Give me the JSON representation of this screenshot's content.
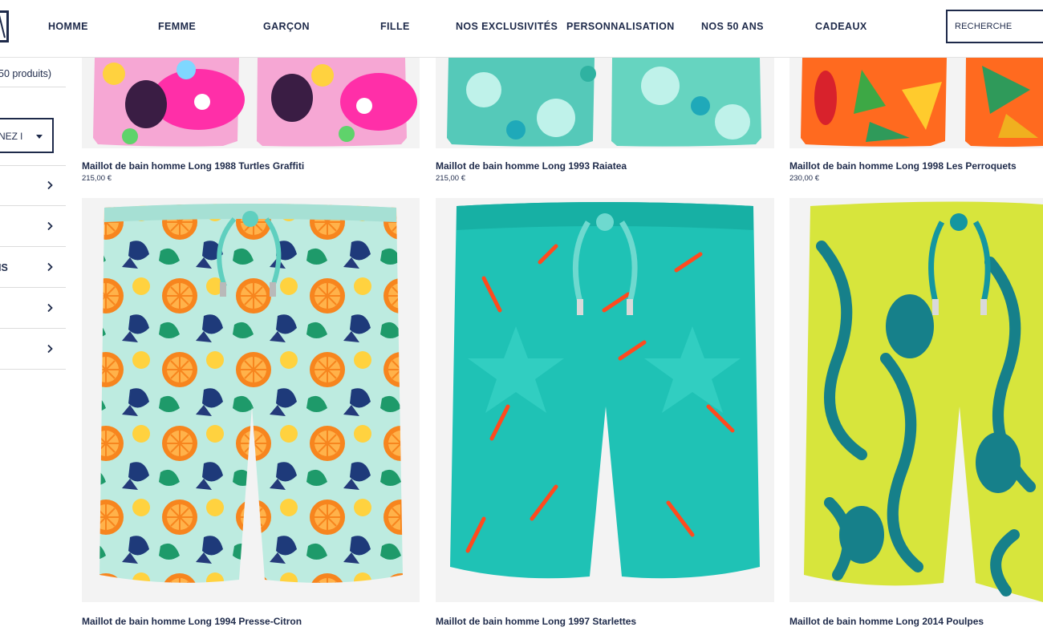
{
  "header": {
    "logo_text": "VB",
    "nav": [
      "HOMME",
      "FEMME",
      "GARÇON",
      "FILLE",
      "NOS EXCLUSIVITÉS",
      "PERSONNALISATION",
      "NOS 50 ANS",
      "CADEAUX"
    ],
    "search_placeholder": "RECHERCHE"
  },
  "sidebar": {
    "count_text": "50 produits)",
    "sort_label": "NEZ l",
    "filters": [
      "",
      "",
      "IS",
      "",
      ""
    ]
  },
  "products": [
    {
      "name": "Maillot de bain homme Long 1988 Turtles Graffiti",
      "price": "215,00 €",
      "pattern": "turtles-graffiti"
    },
    {
      "name": "Maillot de bain homme Long 1993 Raiatea",
      "price": "215,00 €",
      "pattern": "raiatea"
    },
    {
      "name": "Maillot de bain homme Long 1998 Les Perroquets",
      "price": "230,00 €",
      "pattern": "perroquets"
    },
    {
      "name": "Maillot de bain homme Long 1994 Presse-Citron",
      "price": "",
      "pattern": "presse-citron"
    },
    {
      "name": "Maillot de bain homme Long 1997 Starlettes",
      "price": "",
      "pattern": "starlettes"
    },
    {
      "name": "Maillot de bain homme Long 2014 Poulpes",
      "price": "",
      "pattern": "poulpes"
    }
  ],
  "colors": {
    "navy": "#1e2a4a",
    "lemon_bg": "#bdebe0",
    "orange": "#f7851e",
    "turquoise": "#1fc2b5",
    "yellow": "#d7e53c",
    "teal_print": "#16808a"
  }
}
